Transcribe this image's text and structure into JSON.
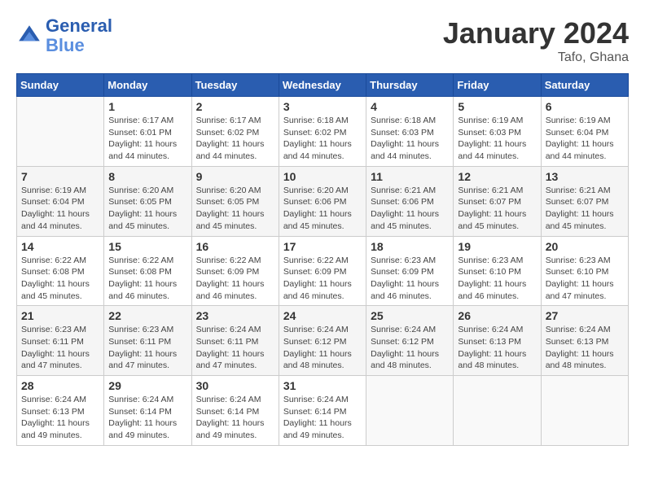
{
  "header": {
    "logo_line1": "General",
    "logo_line2": "Blue",
    "month_year": "January 2024",
    "location": "Tafo, Ghana"
  },
  "columns": [
    "Sunday",
    "Monday",
    "Tuesday",
    "Wednesday",
    "Thursday",
    "Friday",
    "Saturday"
  ],
  "weeks": [
    [
      {
        "day": "",
        "sunrise": "",
        "sunset": "",
        "daylight": ""
      },
      {
        "day": "1",
        "sunrise": "Sunrise: 6:17 AM",
        "sunset": "Sunset: 6:01 PM",
        "daylight": "Daylight: 11 hours and 44 minutes."
      },
      {
        "day": "2",
        "sunrise": "Sunrise: 6:17 AM",
        "sunset": "Sunset: 6:02 PM",
        "daylight": "Daylight: 11 hours and 44 minutes."
      },
      {
        "day": "3",
        "sunrise": "Sunrise: 6:18 AM",
        "sunset": "Sunset: 6:02 PM",
        "daylight": "Daylight: 11 hours and 44 minutes."
      },
      {
        "day": "4",
        "sunrise": "Sunrise: 6:18 AM",
        "sunset": "Sunset: 6:03 PM",
        "daylight": "Daylight: 11 hours and 44 minutes."
      },
      {
        "day": "5",
        "sunrise": "Sunrise: 6:19 AM",
        "sunset": "Sunset: 6:03 PM",
        "daylight": "Daylight: 11 hours and 44 minutes."
      },
      {
        "day": "6",
        "sunrise": "Sunrise: 6:19 AM",
        "sunset": "Sunset: 6:04 PM",
        "daylight": "Daylight: 11 hours and 44 minutes."
      }
    ],
    [
      {
        "day": "7",
        "sunrise": "Sunrise: 6:19 AM",
        "sunset": "Sunset: 6:04 PM",
        "daylight": "Daylight: 11 hours and 44 minutes."
      },
      {
        "day": "8",
        "sunrise": "Sunrise: 6:20 AM",
        "sunset": "Sunset: 6:05 PM",
        "daylight": "Daylight: 11 hours and 45 minutes."
      },
      {
        "day": "9",
        "sunrise": "Sunrise: 6:20 AM",
        "sunset": "Sunset: 6:05 PM",
        "daylight": "Daylight: 11 hours and 45 minutes."
      },
      {
        "day": "10",
        "sunrise": "Sunrise: 6:20 AM",
        "sunset": "Sunset: 6:06 PM",
        "daylight": "Daylight: 11 hours and 45 minutes."
      },
      {
        "day": "11",
        "sunrise": "Sunrise: 6:21 AM",
        "sunset": "Sunset: 6:06 PM",
        "daylight": "Daylight: 11 hours and 45 minutes."
      },
      {
        "day": "12",
        "sunrise": "Sunrise: 6:21 AM",
        "sunset": "Sunset: 6:07 PM",
        "daylight": "Daylight: 11 hours and 45 minutes."
      },
      {
        "day": "13",
        "sunrise": "Sunrise: 6:21 AM",
        "sunset": "Sunset: 6:07 PM",
        "daylight": "Daylight: 11 hours and 45 minutes."
      }
    ],
    [
      {
        "day": "14",
        "sunrise": "Sunrise: 6:22 AM",
        "sunset": "Sunset: 6:08 PM",
        "daylight": "Daylight: 11 hours and 45 minutes."
      },
      {
        "day": "15",
        "sunrise": "Sunrise: 6:22 AM",
        "sunset": "Sunset: 6:08 PM",
        "daylight": "Daylight: 11 hours and 46 minutes."
      },
      {
        "day": "16",
        "sunrise": "Sunrise: 6:22 AM",
        "sunset": "Sunset: 6:09 PM",
        "daylight": "Daylight: 11 hours and 46 minutes."
      },
      {
        "day": "17",
        "sunrise": "Sunrise: 6:22 AM",
        "sunset": "Sunset: 6:09 PM",
        "daylight": "Daylight: 11 hours and 46 minutes."
      },
      {
        "day": "18",
        "sunrise": "Sunrise: 6:23 AM",
        "sunset": "Sunset: 6:09 PM",
        "daylight": "Daylight: 11 hours and 46 minutes."
      },
      {
        "day": "19",
        "sunrise": "Sunrise: 6:23 AM",
        "sunset": "Sunset: 6:10 PM",
        "daylight": "Daylight: 11 hours and 46 minutes."
      },
      {
        "day": "20",
        "sunrise": "Sunrise: 6:23 AM",
        "sunset": "Sunset: 6:10 PM",
        "daylight": "Daylight: 11 hours and 47 minutes."
      }
    ],
    [
      {
        "day": "21",
        "sunrise": "Sunrise: 6:23 AM",
        "sunset": "Sunset: 6:11 PM",
        "daylight": "Daylight: 11 hours and 47 minutes."
      },
      {
        "day": "22",
        "sunrise": "Sunrise: 6:23 AM",
        "sunset": "Sunset: 6:11 PM",
        "daylight": "Daylight: 11 hours and 47 minutes."
      },
      {
        "day": "23",
        "sunrise": "Sunrise: 6:24 AM",
        "sunset": "Sunset: 6:11 PM",
        "daylight": "Daylight: 11 hours and 47 minutes."
      },
      {
        "day": "24",
        "sunrise": "Sunrise: 6:24 AM",
        "sunset": "Sunset: 6:12 PM",
        "daylight": "Daylight: 11 hours and 48 minutes."
      },
      {
        "day": "25",
        "sunrise": "Sunrise: 6:24 AM",
        "sunset": "Sunset: 6:12 PM",
        "daylight": "Daylight: 11 hours and 48 minutes."
      },
      {
        "day": "26",
        "sunrise": "Sunrise: 6:24 AM",
        "sunset": "Sunset: 6:13 PM",
        "daylight": "Daylight: 11 hours and 48 minutes."
      },
      {
        "day": "27",
        "sunrise": "Sunrise: 6:24 AM",
        "sunset": "Sunset: 6:13 PM",
        "daylight": "Daylight: 11 hours and 48 minutes."
      }
    ],
    [
      {
        "day": "28",
        "sunrise": "Sunrise: 6:24 AM",
        "sunset": "Sunset: 6:13 PM",
        "daylight": "Daylight: 11 hours and 49 minutes."
      },
      {
        "day": "29",
        "sunrise": "Sunrise: 6:24 AM",
        "sunset": "Sunset: 6:14 PM",
        "daylight": "Daylight: 11 hours and 49 minutes."
      },
      {
        "day": "30",
        "sunrise": "Sunrise: 6:24 AM",
        "sunset": "Sunset: 6:14 PM",
        "daylight": "Daylight: 11 hours and 49 minutes."
      },
      {
        "day": "31",
        "sunrise": "Sunrise: 6:24 AM",
        "sunset": "Sunset: 6:14 PM",
        "daylight": "Daylight: 11 hours and 49 minutes."
      },
      {
        "day": "",
        "sunrise": "",
        "sunset": "",
        "daylight": ""
      },
      {
        "day": "",
        "sunrise": "",
        "sunset": "",
        "daylight": ""
      },
      {
        "day": "",
        "sunrise": "",
        "sunset": "",
        "daylight": ""
      }
    ]
  ]
}
